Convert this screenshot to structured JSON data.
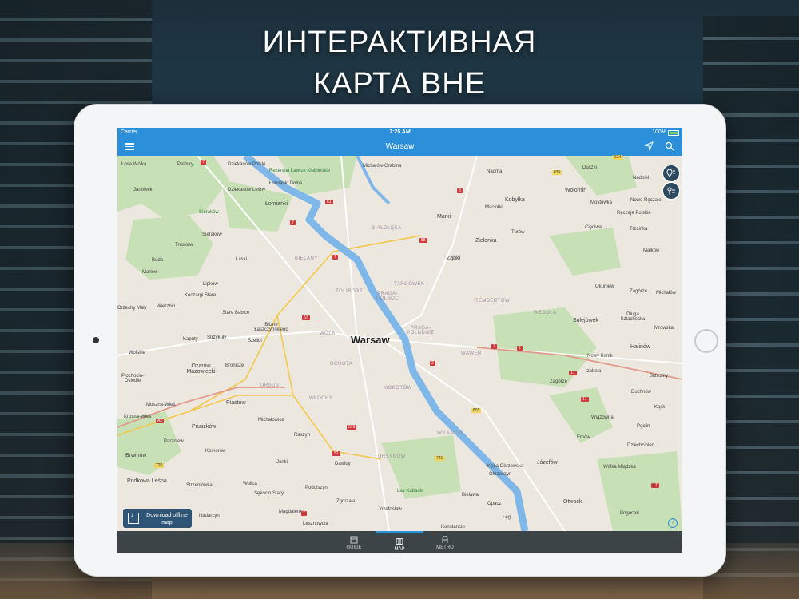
{
  "headline": {
    "line1": "ИНТЕРАКТИВНАЯ",
    "line2": "КАРТА ВНЕ"
  },
  "status": {
    "carrier": "Carrier",
    "time": "7:25 AM",
    "battery": "100%"
  },
  "nav": {
    "title": "Warsaw"
  },
  "colors": {
    "accent": "#2c8fd9",
    "tabbar": "#3d4448",
    "water": "#7fb8e8",
    "park": "#c6dfb4"
  },
  "map": {
    "city": "Warsaw",
    "labels": {
      "losa_wolka": "Łosa Wólka",
      "palmiry": "Palmiry",
      "dziekanow_polski": "Dziekanów Polski",
      "rezerwat": "Rezerwat Ławice Kiełpińskie",
      "michalow_grabina": "Michałów-Grabina",
      "nadma": "Nadma",
      "duczki": "Duczki",
      "nadbiel": "Nadbiel",
      "janowek": "Janówek",
      "dziekanow_lesny": "Dziekanów Leśny",
      "lomianki_dolne": "Łomianki Dolne",
      "kobylka": "Kobyłka",
      "wolomin": "Wołomin",
      "maciolki": "Maciołki",
      "mostowka": "Mostówka",
      "nowe_reczaje": "Nowe Ręczaje",
      "reczaje_polskie": "Ręczaje Polskie",
      "sierakow1": "Sieraków",
      "lomianki": "Łomianki",
      "marki": "Marki",
      "turow": "Turów",
      "ciecina": "Cięciwa",
      "trzcinka": "Trzcinka",
      "bialoleka": "BIAŁOŁĘKA",
      "zielonka": "Zielonka",
      "truskaw": "Truskaw",
      "sierakow2": "Sieraków",
      "zabki": "Ząbki",
      "malkow": "Małków",
      "buda": "Buda",
      "lasek": "Łaski",
      "bielany": "BIELANY",
      "mariew": "Mariew",
      "targowek": "TARGÓWEK",
      "okuniew": "Okuniew",
      "zagorze1": "Zagórze",
      "michalow": "Michałów",
      "lipkow": "Lipków",
      "koczargi": "Koczargi Stare",
      "zoliborz": "ŻOLIBORZ",
      "praga_pn": "PRAGA-PÓŁNOC",
      "rembertow": "REMBERTÓW",
      "orzechy": "Orzechy Mały",
      "wierzbin": "Wierzbin",
      "wesola": "WESOŁA",
      "stare_babice": "Stare Babice",
      "sulejowek": "Sulejówek",
      "dluga": "Długa Szlachecka",
      "blizne": "Blizne Łaszczyńskiego",
      "wola": "WOLA",
      "praga_pd": "PRAGA-POŁUDNIE",
      "mrowka": "Mrowska",
      "kaputy": "Kaputy",
      "strzykuly": "Strzykuły",
      "szeligi": "Szeligi",
      "halinow": "Halinów",
      "welskie": "Wolskie",
      "wawer": "WAWER",
      "nowy_konik": "Nowy Konik",
      "ochota": "OCHOTA",
      "ozarow": "Ożarów Mazowiecki",
      "bronisze": "Bronisze",
      "izabela": "Izabela",
      "brzeziny": "Brzeziny",
      "plochocin": "Płochocin-Osiedle",
      "ursus": "URSUS",
      "zagorze2": "Zagórze",
      "mokotow": "MOKOTÓW",
      "duchnow": "Duchnów",
      "mosznawies": "Moszna-Wieś",
      "piastow": "Piastów",
      "wlochy": "WŁOCHY",
      "kack": "Kąck",
      "krosna": "Krosna-Wieś",
      "michalowice": "Michałowice",
      "wiazowna": "Wiązowna",
      "pruszkow": "Pruszków",
      "peclin": "Pęclin",
      "raszyn": "Raszyn",
      "wilanow": "WILANÓW",
      "emow": "Emów",
      "parzniew": "Parzniew",
      "dziechciniec": "Dziechciniec",
      "komorow": "Komorów",
      "brwinow": "Brwinów",
      "dawidy": "Dawidy",
      "ursynow": "URSYNÓW",
      "kepa": "Kępa Okrzewska",
      "jozefow": "Józefów",
      "janki": "Janki",
      "wolka": "Wólka Mlądzka",
      "okrzeszyn": "Okrzeszyn",
      "podkowa": "Podkowa Leśna",
      "strzeniowka": "Strzeniówka",
      "wolica": "Wolica",
      "podolszyn": "Podolszyn",
      "las_kabacki": "Las Kabacki",
      "sekocin": "Sękocin Stary",
      "bielawa": "Bielawa",
      "zgorzala": "Zgorzała",
      "otwock": "Otwock",
      "opacz": "Opacz",
      "pogorzel": "Pogorzel",
      "magdalenka": "Magdalenka",
      "jozefoslaw": "Józefosław",
      "nadarzyn": "Nadarzyn",
      "leg": "Łęg",
      "lesznowola": "Lesznowola",
      "konstancin": "Konstancin"
    },
    "shields": {
      "s7a": "7",
      "s7b": "7",
      "s635": "635",
      "s634": "634",
      "s8": "8",
      "s61": "61",
      "s58": "58",
      "s7c": "7",
      "s57": "57",
      "s2a": "2",
      "s2b": "2",
      "s2c": "2",
      "s17a": "17",
      "s17b": "17",
      "s801": "801",
      "s579": "579",
      "s52": "52",
      "s721": "721",
      "s720": "720",
      "s17c": "17",
      "s7d": "7",
      "sA2": "A2"
    }
  },
  "download": {
    "label": "Download offline map"
  },
  "tabs": [
    {
      "label": "GUIDE",
      "icon": "guide-icon"
    },
    {
      "label": "MAP",
      "icon": "map-icon"
    },
    {
      "label": "METRO",
      "icon": "metro-icon"
    }
  ]
}
